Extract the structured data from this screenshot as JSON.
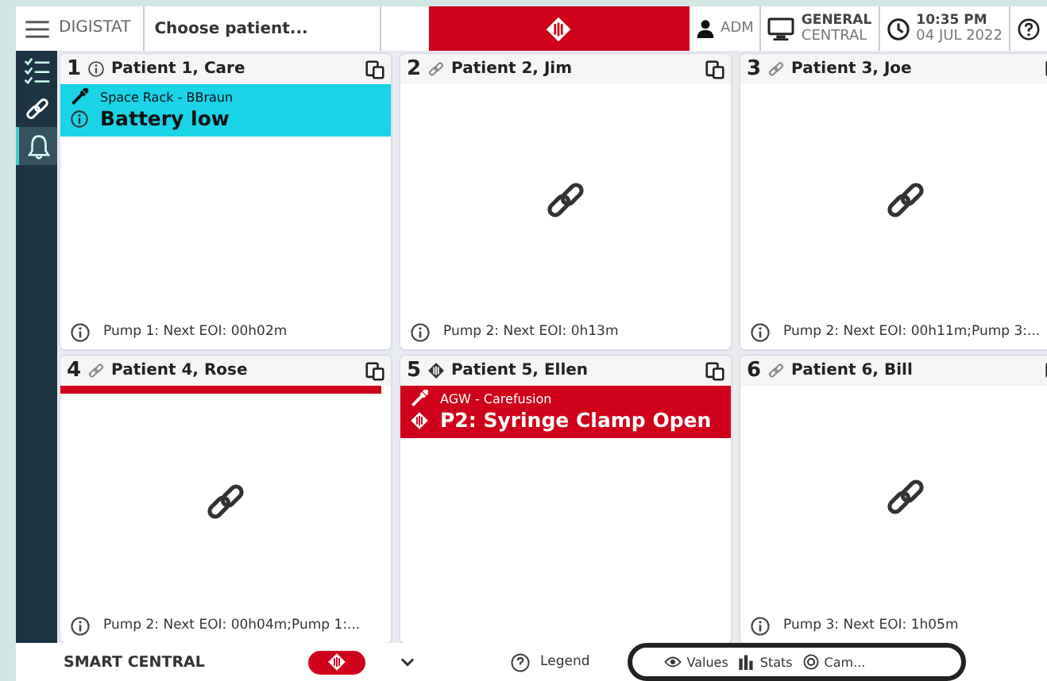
{
  "top_bar": {
    "app_name": "DIGISTAT",
    "patient_field": {
      "placeholder": "Choose patient..."
    },
    "user": "ADM",
    "workstation": [
      "GENERAL",
      "CENTRAL"
    ],
    "time": "10:35 PM",
    "date": "04 JUL 2022"
  },
  "sidebar": {
    "items": [
      {
        "kind": "checklist",
        "selected": false
      },
      {
        "kind": "link",
        "selected": false
      },
      {
        "kind": "bell",
        "selected": true
      }
    ]
  },
  "beds": [
    {
      "number": "1",
      "kind": "info",
      "name": "Patient 1, Care",
      "alert": {
        "color": "#1ad3e6",
        "source": "Space Rack - BBraun",
        "message": "Battery low"
      },
      "alarm_strip": false,
      "linked": false,
      "footer": "Pump 1: Next EOI: 00h02m"
    },
    {
      "number": "2",
      "kind": "link",
      "name": "Patient 2, Jim",
      "alarm_strip": false,
      "linked": true,
      "footer": "Pump 2: Next EOI: 0h13m"
    },
    {
      "number": "3",
      "kind": "link",
      "name": "Patient 3, Joe",
      "alarm_strip": false,
      "linked": true,
      "footer": "Pump 2: Next EOI: 00h11m;Pump 3:..."
    },
    {
      "number": "4",
      "kind": "link",
      "name": "Patient 4, Rose",
      "alarm_strip": true,
      "linked": true,
      "footer": "Pump 2: Next EOI: 00h04m;Pump 1:..."
    },
    {
      "number": "5",
      "kind": "alarm",
      "name": "Patient 5, Ellen",
      "alert": {
        "color": "#d0021b",
        "source": "AGW - Carefusion",
        "message": "P2: Syringe Clamp Open"
      },
      "alarm_strip": false,
      "linked": false
    },
    {
      "number": "6",
      "kind": "link",
      "name": "Patient 6, Bill",
      "alarm_strip": false,
      "linked": true,
      "footer": "Pump 3: Next EOI: 1h05m"
    }
  ],
  "bottom_bar": {
    "title": "SMART CENTRAL",
    "legend": "Legend",
    "views": [
      {
        "kind": "eye",
        "label": "Values"
      },
      {
        "kind": "stats",
        "label": "Stats"
      },
      {
        "kind": "camera",
        "label": "Cam..."
      }
    ]
  }
}
